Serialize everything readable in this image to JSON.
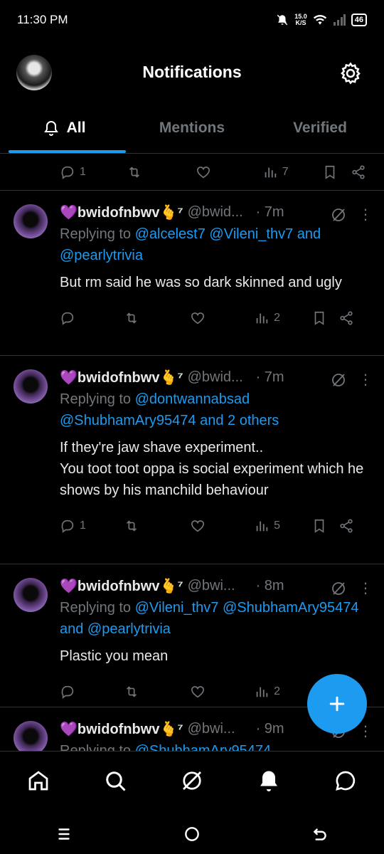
{
  "status": {
    "time": "11:30 PM",
    "net_speed": "15.0",
    "net_unit": "K/S",
    "battery": "46"
  },
  "header": {
    "title": "Notifications"
  },
  "tabs": [
    {
      "label": "All"
    },
    {
      "label": "Mentions"
    },
    {
      "label": "Verified"
    }
  ],
  "top_actions": {
    "replies": "1",
    "views": "7"
  },
  "posts": [
    {
      "name": "💜bwidofnbwv🫰⁷",
      "handle": "@bwid...",
      "time": "· 7m",
      "reply_prefix": "Replying to",
      "reply_links": "@alcelest7 @Vileni_thv7 and @pearlytrivia",
      "text": "But rm said he was so dark skinned and ugly",
      "replies": "",
      "views": "2"
    },
    {
      "name": "💜bwidofnbwv🫰⁷",
      "handle": "@bwid...",
      "time": "· 7m",
      "reply_prefix": "Replying to",
      "reply_links": "@dontwannabsad @ShubhamAry95474 and 2 others",
      "text": "If they're jaw shave experiment..\nYou toot toot oppa is social experiment which he shows by his manchild behaviour",
      "replies": "1",
      "views": "5"
    },
    {
      "name": "💜bwidofnbwv🫰⁷",
      "handle": "@bwi...",
      "time": "· 8m",
      "reply_prefix": "Replying to",
      "reply_links": "@Vileni_thv7 @ShubhamAry95474 and @pearlytrivia",
      "text": "Plastic you mean",
      "replies": "",
      "views": "2"
    },
    {
      "name": "💜bwidofnbwv🫰⁷",
      "handle": "@bwi...",
      "time": "· 9m",
      "reply_prefix": "Replying to",
      "reply_links": "@ShubhamAry95474",
      "text": "",
      "replies": "",
      "views": ""
    }
  ],
  "colors": {
    "accent": "#1d9bf0",
    "muted": "#71767b",
    "background": "#000000",
    "divider": "#2f3336"
  },
  "icons": [
    "bell-icon",
    "gear-icon",
    "reply-icon",
    "retweet-icon",
    "heart-icon",
    "views-icon",
    "bookmark-icon",
    "share-icon",
    "grok-icon",
    "more-icon",
    "plus-icon",
    "home-icon",
    "search-icon",
    "message-icon"
  ]
}
